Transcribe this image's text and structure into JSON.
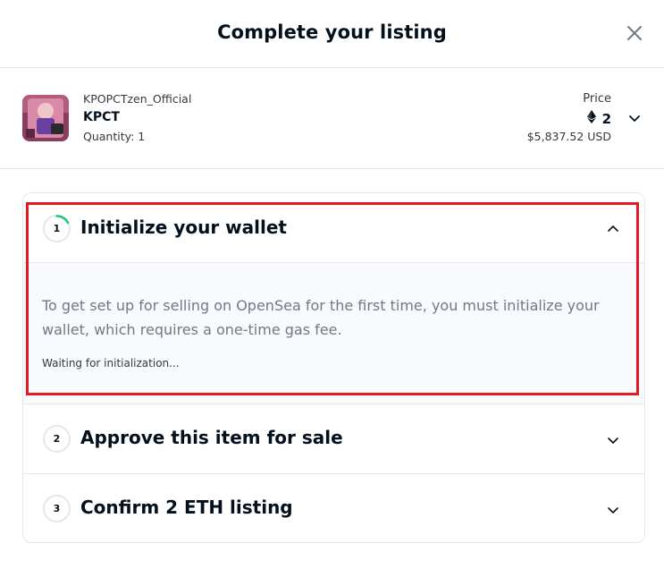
{
  "modal": {
    "title": "Complete your listing",
    "close_icon": "close-icon"
  },
  "item": {
    "collection": "KPOPCTzen_Official",
    "name": "KPCT",
    "quantity": "Quantity: 1",
    "price_label": "Price",
    "price_eth": "2",
    "price_usd": "$5,837.52 USD",
    "currency_icon": "ethereum-icon"
  },
  "steps": [
    {
      "number": "1",
      "title": "Initialize your wallet",
      "expanded": true,
      "description": "To get set up for selling on OpenSea for the first time, you must initialize your wallet, which requires a one-time gas fee.",
      "status": "Waiting for initialization..."
    },
    {
      "number": "2",
      "title": "Approve this item for sale",
      "expanded": false
    },
    {
      "number": "3",
      "title": "Confirm 2 ETH listing",
      "expanded": false
    }
  ],
  "colors": {
    "highlight": "#e01b24",
    "spinner": "#20c57e",
    "border": "#e5e8eb",
    "text_primary": "#04111d",
    "text_secondary": "#707a83"
  }
}
